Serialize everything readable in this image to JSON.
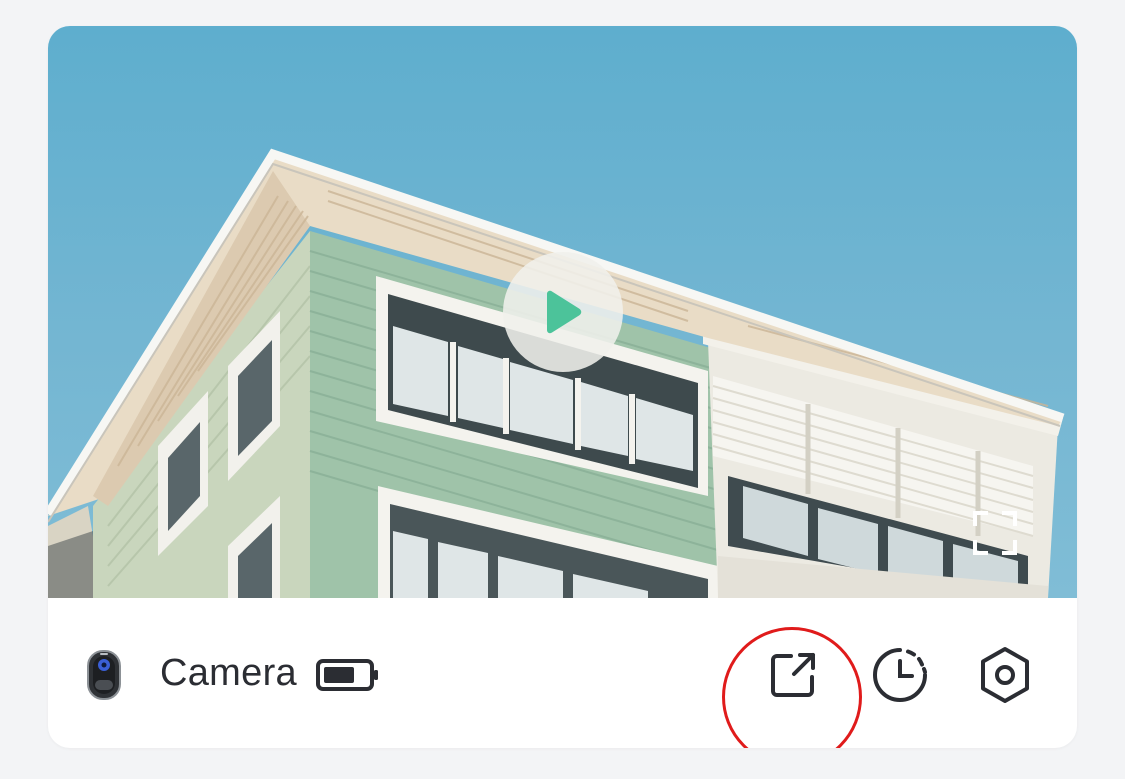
{
  "device": {
    "name": "Camera",
    "battery_level": 0.7
  },
  "preview": {
    "play_icon": "play-icon",
    "fullscreen_icon": "fullscreen-icon"
  },
  "actions": [
    {
      "icon": "share-external-icon"
    },
    {
      "icon": "history-clock-icon"
    },
    {
      "icon": "settings-hexagon-icon"
    }
  ],
  "colors": {
    "accent": "#4cc39a",
    "text": "#2b2d33",
    "highlight": "#e01b1b",
    "background": "#f3f4f6"
  }
}
